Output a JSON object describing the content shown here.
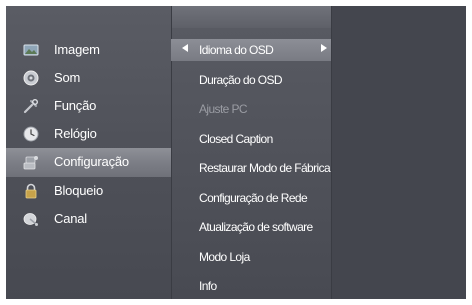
{
  "main_menu": {
    "items": [
      {
        "label": "Imagem",
        "icon": "picture-icon"
      },
      {
        "label": "Som",
        "icon": "speaker-icon"
      },
      {
        "label": "Função",
        "icon": "tools-icon"
      },
      {
        "label": "Relógio",
        "icon": "clock-icon"
      },
      {
        "label": "Configuração",
        "icon": "settings-icon"
      },
      {
        "label": "Bloqueio",
        "icon": "lock-icon"
      },
      {
        "label": "Canal",
        "icon": "satellite-dish-icon"
      }
    ],
    "selected": "Configuração"
  },
  "submenu": {
    "items": [
      {
        "label": "Idioma do OSD",
        "enabled": true
      },
      {
        "label": "Duração do OSD",
        "enabled": true
      },
      {
        "label": "Ajuste PC",
        "enabled": false
      },
      {
        "label": "Closed Caption",
        "enabled": true
      },
      {
        "label": "Restaurar Modo de Fábrica",
        "enabled": true
      },
      {
        "label": "Configuração de Rede",
        "enabled": true
      },
      {
        "label": "Atualização de software",
        "enabled": true
      },
      {
        "label": "Modo Loja",
        "enabled": true
      },
      {
        "label": "Info",
        "enabled": true
      }
    ],
    "selected": "Idioma do OSD"
  },
  "colors": {
    "background": "#4c4e56",
    "highlight": "#7c7e86",
    "text": "#ffffff",
    "disabled_text": "#9a9ca3"
  }
}
